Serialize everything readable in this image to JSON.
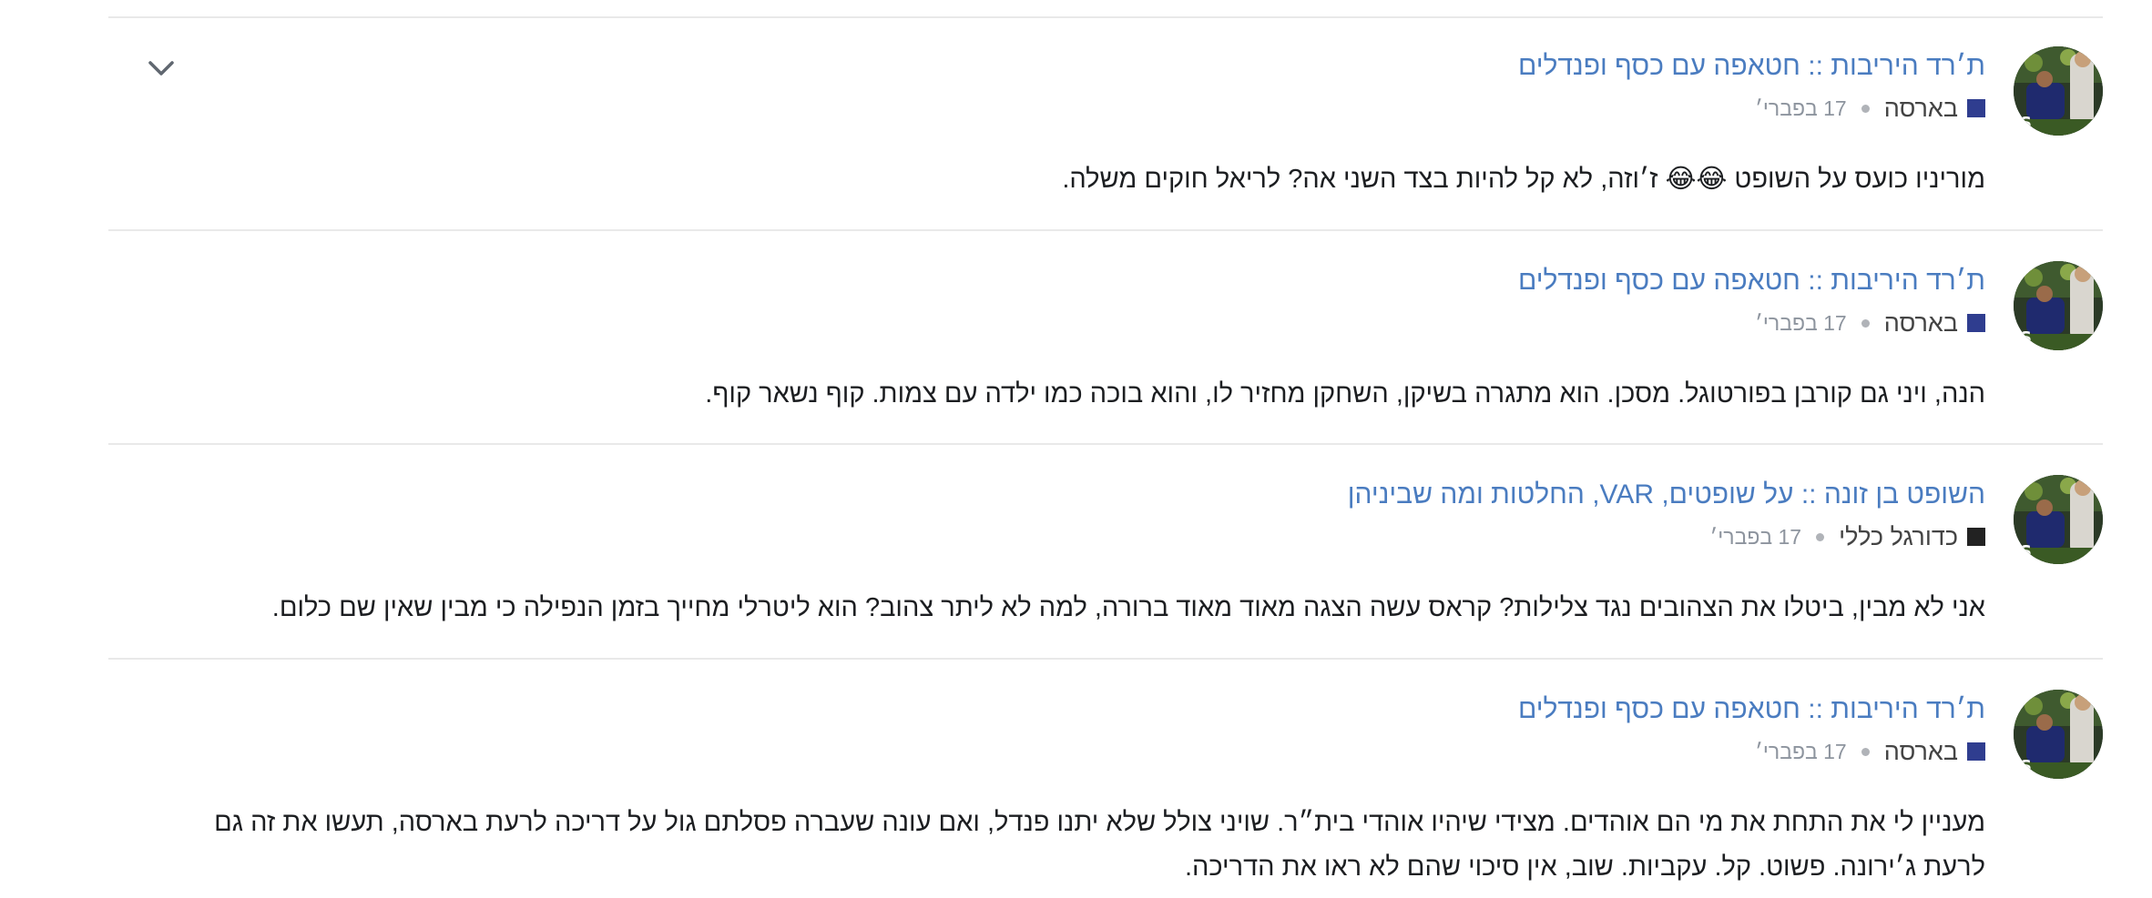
{
  "colors": {
    "link": "#4a7cc0",
    "forum_barsa": "#2f3d8f",
    "forum_general": "#222222",
    "divider": "#e9e9e9"
  },
  "icons": {
    "expand": "chevron-down-icon",
    "separator": "dot-separator-icon"
  },
  "posts": [
    {
      "title": "ת׳רד היריבות :: חטאפה עם כסף ופנדלים",
      "forum": "בארסה",
      "date": "17 בפברי׳",
      "text": "מוריניו כועס על השופט 😂😂 ז׳וזה, לא קל להיות בצד השני אה? לריאל חוקים משלה."
    },
    {
      "title": "ת׳רד היריבות :: חטאפה עם כסף ופנדלים",
      "forum": "בארסה",
      "date": "17 בפברי׳",
      "text": "הנה, ויני גם קורבן בפורטוגל. מסכן. הוא מתגרה בשיקן, השחקן מחזיר לו, והוא בוכה כמו ילדה עם צמות. קוף נשאר קוף."
    },
    {
      "title": "השופט בן זונה :: על שופטים, VAR, החלטות ומה שביניהן",
      "forum": "כדורגל כללי",
      "date": "17 בפברי׳",
      "text": "אני לא מבין, ביטלו את הצהובים נגד צלילות? קראס עשה הצגה מאוד מאוד ברורה, למה לא ליתר צהוב? הוא ליטרלי מחייך בזמן הנפילה כי מבין שאין שם כלום."
    },
    {
      "title": "ת׳רד היריבות :: חטאפה עם כסף ופנדלים",
      "forum": "בארסה",
      "date": "17 בפברי׳",
      "text": "מעניין לי את התחת את מי הם אוהדים. מצידי שיהיו אוהדי בית״ר. שויני צולל שלא יתנו פנדל, ואם עונה שעברה פסלתם גול על דריכה לרעת בארסה, תעשו את זה גם לרעת ג׳ירונה. פשוט. קל. עקביות. שוב, אין סיכוי שהם לא ראו את הדריכה."
    }
  ]
}
